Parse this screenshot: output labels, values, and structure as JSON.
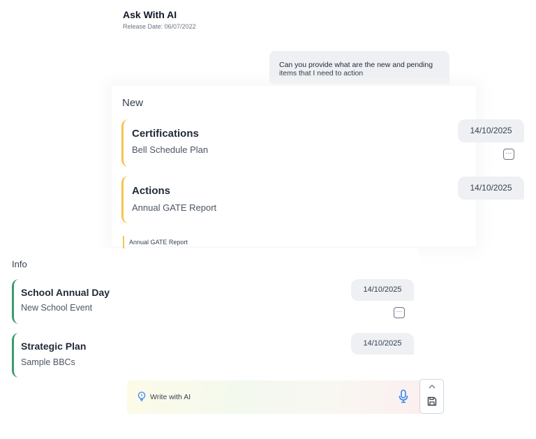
{
  "header": {
    "title": "Ask With AI",
    "release": "Release Date: 06/07/2022"
  },
  "chat": {
    "user_message": "Can you provide what are the new and pending items that I need to action"
  },
  "new_section": {
    "label": "New",
    "cards": [
      {
        "title": "Certifications",
        "subtitle": "Bell Schedule Plan",
        "date": "14/10/2025"
      },
      {
        "title": "Actions",
        "subtitle": "Annual GATE Report",
        "date": "14/10/2025"
      }
    ],
    "faded_row_label": "Annual GATE Report"
  },
  "info_section": {
    "label": "Info",
    "cards": [
      {
        "title": "School Annual Day",
        "subtitle": "New School Event",
        "date": "14/10/2025"
      },
      {
        "title": "Strategic Plan",
        "subtitle": "Sample BBCs",
        "date": "14/10/2025"
      }
    ]
  },
  "composer": {
    "placeholder": "Write with AI"
  },
  "icons": {
    "more": "more-horizontal-icon",
    "bulb": "lightbulb-icon",
    "mic": "microphone-icon",
    "chevron": "chevron-up-icon",
    "save": "save-icon"
  },
  "colors": {
    "new_accent": "#f5c451",
    "info_accent": "#3a9c6b",
    "mic_blue": "#3b82f6",
    "bubble_bg": "#eef0f3"
  }
}
